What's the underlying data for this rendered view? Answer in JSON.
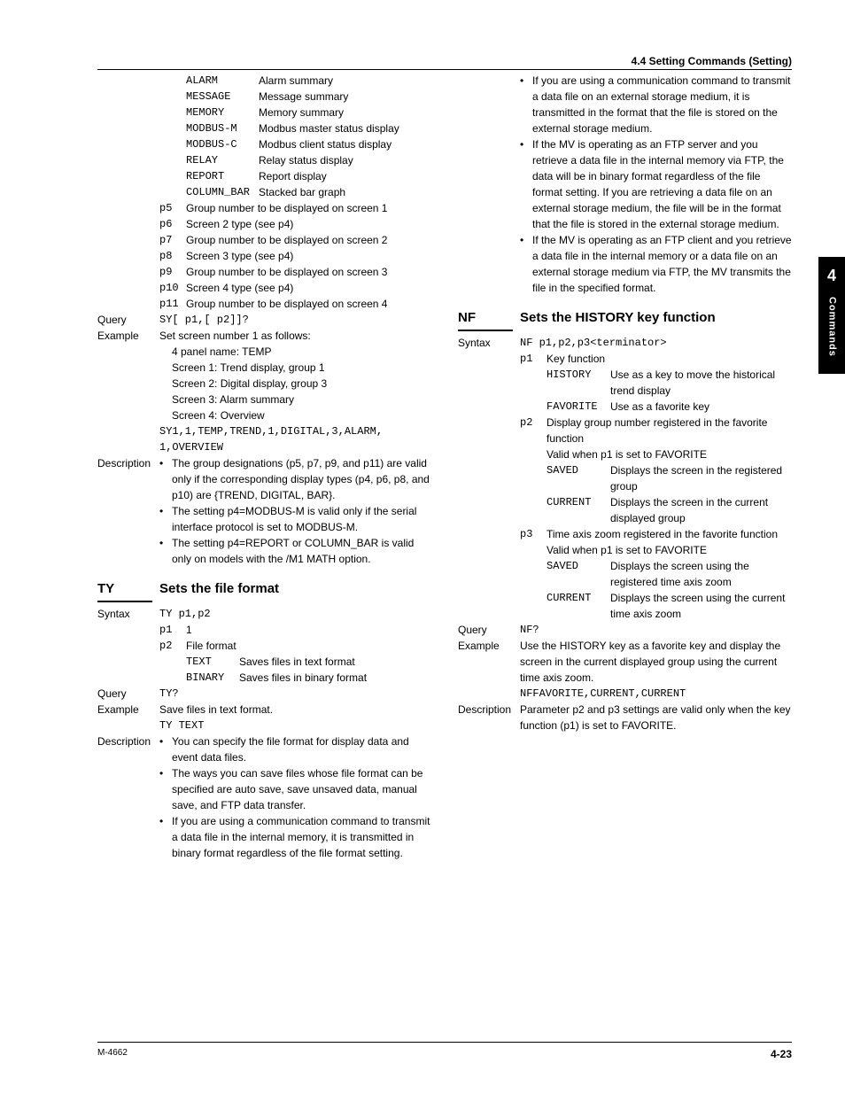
{
  "header": "4.4  Setting Commands (Setting)",
  "sideTab": {
    "chapter": "4",
    "label": "Commands"
  },
  "footer": {
    "doc": "M-4662",
    "page": "4-23"
  },
  "left": {
    "paramTable": [
      {
        "key": "ALARM",
        "val": "Alarm summary"
      },
      {
        "key": "MESSAGE",
        "val": "Message summary"
      },
      {
        "key": "MEMORY",
        "val": "Memory summary"
      },
      {
        "key": "MODBUS-M",
        "val": "Modbus master status display"
      },
      {
        "key": "MODBUS-C",
        "val": "Modbus client status display"
      },
      {
        "key": "RELAY",
        "val": "Relay status display"
      },
      {
        "key": "REPORT",
        "val": "Report display"
      },
      {
        "key": "COLUMN_BAR",
        "val": "Stacked bar graph"
      }
    ],
    "pRows": [
      {
        "p": "p5",
        "txt": "Group number to be displayed on screen 1"
      },
      {
        "p": "p6",
        "txt": "Screen 2 type (see p4)"
      },
      {
        "p": "p7",
        "txt": "Group number to be displayed on screen 2"
      },
      {
        "p": "p8",
        "txt": "Screen 3 type (see p4)"
      },
      {
        "p": "p9",
        "txt": "Group number to be displayed on screen 3"
      },
      {
        "p": "p10",
        "txt": "Screen 4 type (see p4)"
      },
      {
        "p": "p11",
        "txt": "Group number to be displayed on screen 4"
      }
    ],
    "queryLabel": "Query",
    "querySyntax": "SY[ p1,[ p2]]?",
    "exampleLabel": "Example",
    "exampleLines": [
      "Set screen number 1 as follows:",
      "4 panel name: TEMP",
      "Screen 1: Trend display, group 1",
      "Screen 2: Digital display, group 3",
      "Screen 3: Alarm summary",
      "Screen 4: Overview"
    ],
    "exampleCode": [
      "SY1,1,TEMP,TREND,1,DIGITAL,3,ALARM,",
      "1,OVERVIEW"
    ],
    "descLabel": "Description",
    "descBullets": [
      "The group designations (p5, p7, p9, and p11) are valid only if the corresponding display types (p4, p6, p8, and p10) are {TREND, DIGITAL, BAR}.",
      "The setting p4=MODBUS-M is valid only if the serial interface protocol is set to MODBUS-M.",
      "The setting p4=REPORT or COLUMN_BAR is valid only on models with the /M1 MATH option."
    ],
    "ty": {
      "name": "TY",
      "title": "Sets the file format",
      "syntaxLabel": "Syntax",
      "syntax": "TY p1,p2",
      "p1": {
        "p": "p1",
        "txt": "1"
      },
      "p2": {
        "p": "p2",
        "txt": "File format"
      },
      "p2opts": [
        {
          "key": "TEXT",
          "val": "Saves files in text format"
        },
        {
          "key": "BINARY",
          "val": "Saves files in binary format"
        }
      ],
      "queryLabel": "Query",
      "query": "TY?",
      "exampleLabel": "Example",
      "exampleText": "Save files in text format.",
      "exampleCode": "TY TEXT",
      "descLabel": "Description",
      "descBullets": [
        "You can specify the file format for display data and event data files.",
        "The ways you can save files whose file format can be specified are auto save, save unsaved data, manual save, and FTP data transfer.",
        "If you are using a communication command to transmit a data file in the internal memory, it is transmitted in binary format regardless of the file format setting."
      ]
    }
  },
  "right": {
    "contBullets": [
      "If you are using a communication command to transmit a data file on an external storage medium, it is transmitted in the format that the file is stored on the external storage medium.",
      "If the MV is operating as an FTP server and you retrieve a data file in the internal memory via FTP, the data will be in binary format regardless of the file format setting. If you are retrieving a data file on an external storage medium, the file will be in the format that the file is stored in the external storage medium.",
      "If the MV is operating as an FTP client and you retrieve a data file in the internal memory or a data file on an external storage medium via FTP, the MV transmits the file in the specified format."
    ],
    "nf": {
      "name": "NF",
      "title": "Sets the HISTORY key function",
      "syntaxLabel": "Syntax",
      "syntax": "NF p1,p2,p3<terminator>",
      "p1": {
        "p": "p1",
        "txt": "Key function",
        "opts": [
          {
            "key": "HISTORY",
            "val": "Use as a key to move the historical trend display"
          },
          {
            "key": "FAVORITE",
            "val": "Use as a favorite key"
          }
        ]
      },
      "p2": {
        "p": "p2",
        "txt": "Display group number registered in the favorite function",
        "valid": "Valid when p1 is set to FAVORITE",
        "opts": [
          {
            "key": "SAVED",
            "val": "Displays the screen in the registered group"
          },
          {
            "key": "CURRENT",
            "val": "Displays the screen in the current displayed group"
          }
        ]
      },
      "p3": {
        "p": "p3",
        "txt": "Time axis zoom registered in the favorite function",
        "valid": "Valid when p1 is set to FAVORITE",
        "opts": [
          {
            "key": "SAVED",
            "val": "Displays the screen using the registered time axis zoom"
          },
          {
            "key": "CURRENT",
            "val": "Displays the screen using the current time axis zoom"
          }
        ]
      },
      "queryLabel": "Query",
      "query": "NF?",
      "exampleLabel": "Example",
      "exampleText": "Use the HISTORY key as a favorite key and display the screen in the current displayed group using the current time axis zoom.",
      "exampleCode": "NFFAVORITE,CURRENT,CURRENT",
      "descLabel": "Description",
      "descText": "Parameter p2 and p3 settings are valid only when the key function (p1) is set to FAVORITE."
    }
  }
}
